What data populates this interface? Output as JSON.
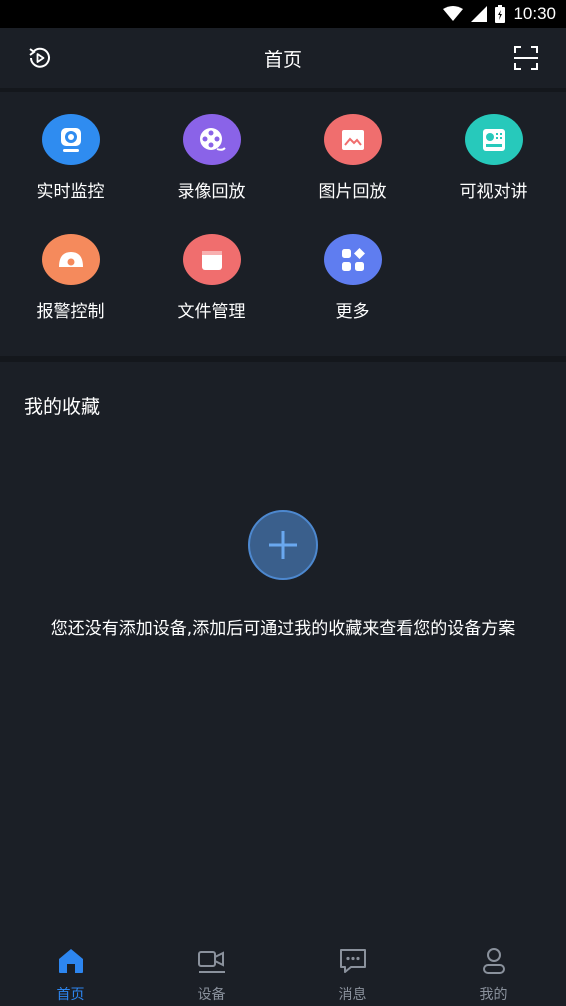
{
  "status": {
    "time": "10:30"
  },
  "header": {
    "title": "首页"
  },
  "tiles": [
    {
      "label": "实时监控",
      "icon": "camera-icon",
      "color": "#2f8cf0"
    },
    {
      "label": "录像回放",
      "icon": "film-reel-icon",
      "color": "#8a63e8"
    },
    {
      "label": "图片回放",
      "icon": "image-icon",
      "color": "#f06e6e"
    },
    {
      "label": "可视对讲",
      "icon": "intercom-icon",
      "color": "#27c9bb"
    },
    {
      "label": "报警控制",
      "icon": "alarm-icon",
      "color": "#f58a5c"
    },
    {
      "label": "文件管理",
      "icon": "folder-icon",
      "color": "#f06e6e"
    },
    {
      "label": "更多",
      "icon": "more-grid-icon",
      "color": "#5f7df0"
    }
  ],
  "favorites": {
    "title": "我的收藏",
    "empty_text": "您还没有添加设备,添加后可通过我的收藏来查看您的设备方案"
  },
  "nav": [
    {
      "label": "首页",
      "icon": "home-icon",
      "active": true
    },
    {
      "label": "设备",
      "icon": "device-icon",
      "active": false
    },
    {
      "label": "消息",
      "icon": "message-icon",
      "active": false
    },
    {
      "label": "我的",
      "icon": "profile-icon",
      "active": false
    }
  ],
  "colors": {
    "accent": "#2d86f0",
    "background": "#1b1f26"
  }
}
